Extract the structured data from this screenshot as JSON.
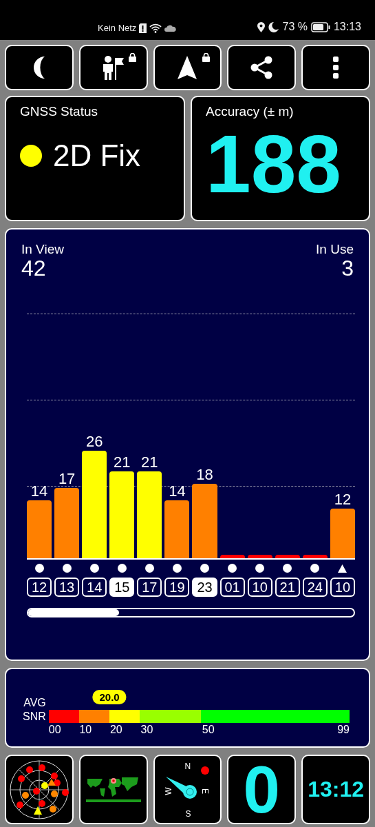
{
  "status_bar": {
    "carrier": "Kein Netz",
    "battery": "73 %",
    "time": "13:13"
  },
  "toolbar": [
    {
      "kind": "night",
      "locked": false
    },
    {
      "kind": "person",
      "locked": true
    },
    {
      "kind": "navigate",
      "locked": true
    },
    {
      "kind": "share",
      "locked": false
    },
    {
      "kind": "more",
      "locked": false
    }
  ],
  "gnss_status": {
    "title": "GNSS Status",
    "value": "2D Fix",
    "color": "#ffff00"
  },
  "accuracy": {
    "title": "Accuracy (± m)",
    "value": "188"
  },
  "satellites_panel": {
    "in_view_label": "In View",
    "in_view": "42",
    "in_use_label": "In Use",
    "in_use": "3",
    "satellites": [
      {
        "snr": "14",
        "color": "#ff8000",
        "kind": "dot",
        "id": "12",
        "selected": false
      },
      {
        "snr": "17",
        "color": "#ff8000",
        "kind": "dot",
        "id": "13",
        "selected": false
      },
      {
        "snr": "26",
        "color": "#ffff00",
        "kind": "dot",
        "id": "14",
        "selected": false
      },
      {
        "snr": "21",
        "color": "#ffff00",
        "kind": "dot",
        "id": "15",
        "selected": true
      },
      {
        "snr": "21",
        "color": "#ffff00",
        "kind": "dot",
        "id": "17",
        "selected": false
      },
      {
        "snr": "14",
        "color": "#ff8000",
        "kind": "dot",
        "id": "19",
        "selected": false
      },
      {
        "snr": "18",
        "color": "#ff8000",
        "kind": "dot",
        "id": "23",
        "selected": true
      },
      {
        "color": "#ff0000",
        "kind": "dot",
        "id": "01",
        "selected": false
      },
      {
        "color": "#ff0000",
        "kind": "dot",
        "id": "10",
        "selected": false
      },
      {
        "color": "#ff0000",
        "kind": "dot",
        "id": "21",
        "selected": false
      },
      {
        "color": "#ff0000",
        "kind": "dot",
        "id": "24",
        "selected": false
      },
      {
        "snr": "12",
        "color": "#ff8000",
        "kind": "triangle",
        "id": "10",
        "selected": false
      }
    ]
  },
  "avg_snr": {
    "label_1": "AVG",
    "label_2": "SNR",
    "value": "20.0",
    "segments": [
      {
        "tick": "00",
        "color": "#ff0000"
      },
      {
        "tick": "10",
        "color": "#ff8000"
      },
      {
        "tick": "20",
        "color": "#ffff00"
      },
      {
        "tick": "30",
        "color": "#99ff00"
      },
      {
        "tick": "50",
        "color": "#00ff00"
      }
    ],
    "end_tick": "99"
  },
  "tiles": {
    "compass": {
      "north": "N",
      "east": "E",
      "south": "S",
      "west": "W"
    },
    "satellites_in_use": "0",
    "clock": "13:12"
  }
}
